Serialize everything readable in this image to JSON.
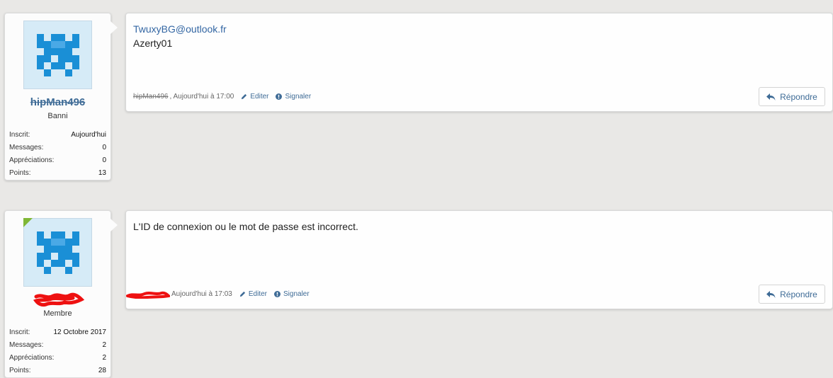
{
  "posts": [
    {
      "username": "hipMan496",
      "user_title": "Banni",
      "stats": [
        {
          "key": "Inscrit:",
          "value": "Aujourd'hui"
        },
        {
          "key": "Messages:",
          "value": "0"
        },
        {
          "key": "Appréciations:",
          "value": "0"
        },
        {
          "key": "Points:",
          "value": "13"
        }
      ],
      "message_link": "TwuxyBG@outlook.fr",
      "message_line": "Azerty01",
      "meta_author": "hipMan496",
      "meta_date": ", Aujourd'hui à 17:00",
      "edit_label": "Editer",
      "report_label": "Signaler",
      "reply_label": "Répondre"
    },
    {
      "username": "",
      "user_title": "Membre",
      "stats": [
        {
          "key": "Inscrit:",
          "value": "12 Octobre 2017"
        },
        {
          "key": "Messages:",
          "value": "2"
        },
        {
          "key": "Appréciations:",
          "value": "2"
        },
        {
          "key": "Points:",
          "value": "28"
        }
      ],
      "message_line": "L'ID de connexion ou le mot de passe est incorrect.",
      "meta_date": "Aujourd'hui à 17:03",
      "edit_label": "Editer",
      "report_label": "Signaler",
      "reply_label": "Répondre"
    }
  ],
  "colors": {
    "link": "#3e6b96",
    "online": "#7fb736",
    "avatar_blue": "#1a8fd6",
    "redaction": "#ee1111"
  },
  "icons": [
    "pencil-icon",
    "exclamation-circle-icon",
    "reply-arrow-icon",
    "avatar-identicon"
  ]
}
